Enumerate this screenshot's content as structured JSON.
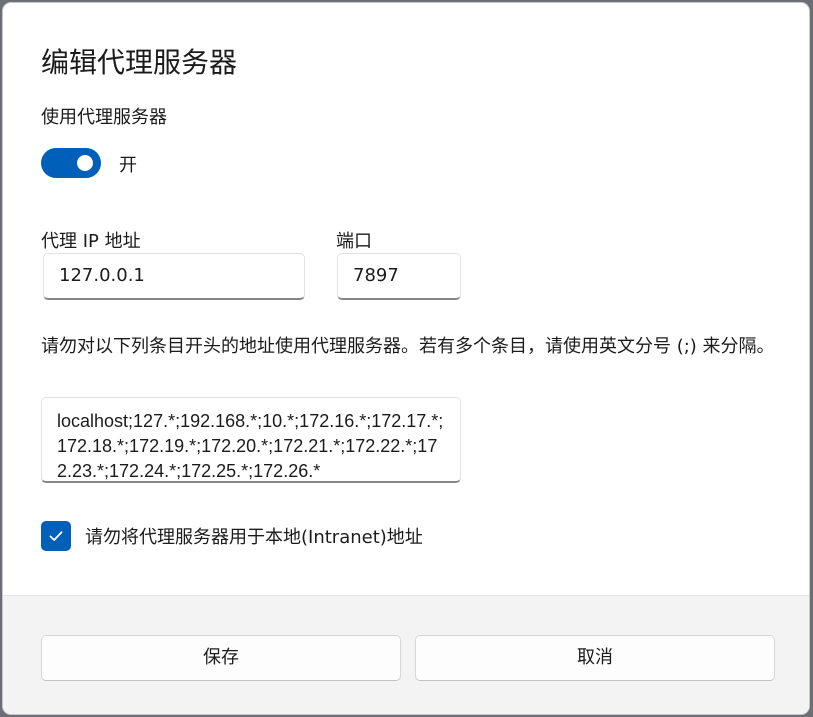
{
  "dialog": {
    "title": "编辑代理服务器"
  },
  "proxy_toggle": {
    "label": "使用代理服务器",
    "state_text": "开",
    "enabled": true
  },
  "ip_field": {
    "label": "代理 IP 地址",
    "value": "127.0.0.1"
  },
  "port_field": {
    "label": "端口",
    "value": "7897"
  },
  "exceptions": {
    "description": "请勿对以下列条目开头的地址使用代理服务器。若有多个条目，请使用英文分号 (;) 来分隔。",
    "value": "localhost;127.*;192.168.*;10.*;172.16.*;172.17.*;172.18.*;172.19.*;172.20.*;172.21.*;172.22.*;172.23.*;172.24.*;172.25.*;172.26.*"
  },
  "local_bypass": {
    "label": "请勿将代理服务器用于本地(Intranet)地址",
    "checked": true
  },
  "buttons": {
    "save": "保存",
    "cancel": "取消"
  },
  "colors": {
    "accent": "#005fb8",
    "footer_bg": "#f3f3f3"
  },
  "icons": {
    "checkbox_mark": "checkmark-icon",
    "toggle": "toggle-on"
  }
}
